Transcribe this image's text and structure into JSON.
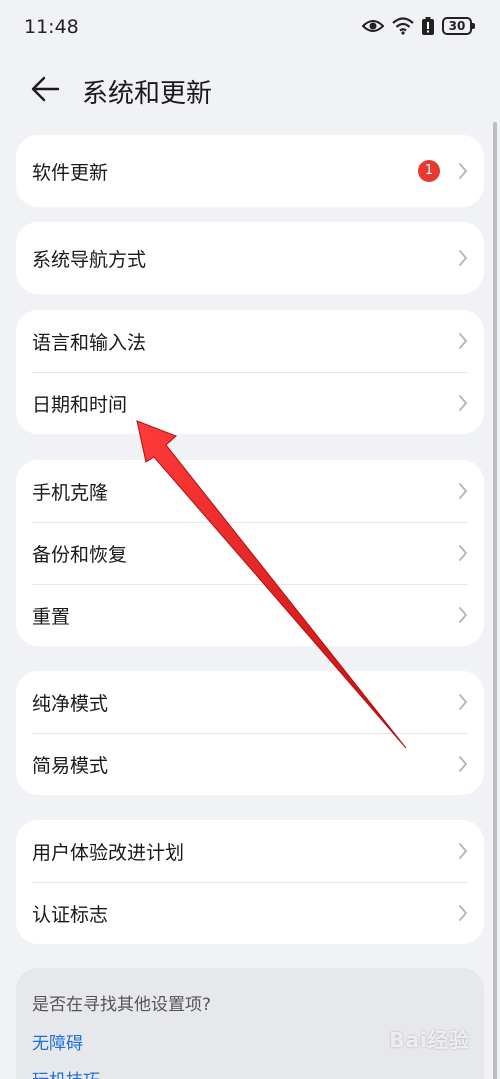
{
  "status_bar": {
    "time": "11:48",
    "battery": "30",
    "icons": [
      "eye-icon",
      "wifi-icon",
      "battery-alert-icon",
      "battery-icon"
    ]
  },
  "header": {
    "back_icon": "arrow-left-icon",
    "title": "系统和更新"
  },
  "groups": {
    "g1": {
      "items": [
        {
          "label": "软件更新",
          "badge": "1"
        }
      ]
    },
    "g2": {
      "items": [
        {
          "label": "系统导航方式"
        }
      ]
    },
    "g3": {
      "items": [
        {
          "label": "语言和输入法"
        },
        {
          "label": "日期和时间"
        }
      ]
    },
    "g4": {
      "items": [
        {
          "label": "手机克隆"
        },
        {
          "label": "备份和恢复"
        },
        {
          "label": "重置"
        }
      ]
    },
    "g5": {
      "items": [
        {
          "label": "纯净模式"
        },
        {
          "label": "简易模式"
        }
      ]
    },
    "g6": {
      "items": [
        {
          "label": "用户体验改进计划"
        },
        {
          "label": "认证标志"
        }
      ]
    }
  },
  "suggestions": {
    "title": "是否在寻找其他设置项?",
    "links": [
      "无障碍",
      "玩机技巧"
    ]
  },
  "annotation": {
    "color": "#e01a1a",
    "points_to": "日期和时间"
  },
  "watermark": "Bai经验",
  "colors": {
    "badge": "#e8382f",
    "link": "#1f6fd6",
    "background": "#f1f2f5"
  }
}
